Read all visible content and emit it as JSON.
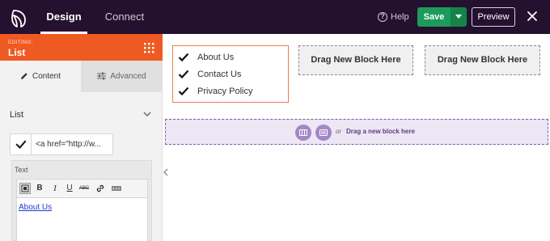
{
  "topbar": {
    "tabs": [
      {
        "label": "Design"
      },
      {
        "label": "Connect"
      }
    ],
    "help_label": "Help",
    "save_label": "Save",
    "preview_label": "Preview",
    "background": "#24102f",
    "save_color": "#1c9b5a"
  },
  "sidebar": {
    "editing_label": "EDITING:",
    "editing_name": "List",
    "header_color": "#ef5a23",
    "tabs": [
      {
        "label": "Content",
        "icon": "pencil-icon"
      },
      {
        "label": "Advanced",
        "icon": "sliders-icon"
      }
    ],
    "section_title": "List",
    "list_item_value": "<a href=\"http://w...",
    "text_label": "Text",
    "toolbar_buttons": [
      "format-icon",
      "B",
      "I",
      "U",
      "ABC",
      "link-icon",
      "more-icon"
    ],
    "editor_content": "About Us"
  },
  "canvas": {
    "list_items": [
      "About Us",
      "Contact Us",
      "Privacy Policy"
    ],
    "drop_blocks": [
      "Drag New Block Here",
      "Drag New Block Here"
    ],
    "section_or": "or",
    "section_drag": "Drag a new block here"
  }
}
